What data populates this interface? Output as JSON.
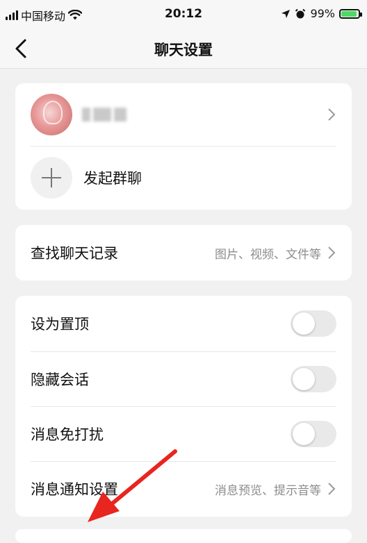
{
  "status_bar": {
    "carrier": "中国移动",
    "time": "20:12",
    "battery_text": "99%",
    "battery_level": 0.99
  },
  "nav": {
    "title": "聊天设置"
  },
  "members": {
    "add_label": "发起群聊"
  },
  "search_history": {
    "label": "查找聊天记录",
    "value": "图片、视频、文件等"
  },
  "settings": {
    "pin": {
      "label": "设为置顶",
      "on": false
    },
    "hide": {
      "label": "隐藏会话",
      "on": false
    },
    "mute": {
      "label": "消息免打扰",
      "on": false
    },
    "notify": {
      "label": "消息通知设置",
      "value": "消息预览、提示音等"
    }
  },
  "colors": {
    "accent_arrow": "#e8251f",
    "toggle_off": "#e9e9e9",
    "battery_fill": "#4cd964"
  }
}
